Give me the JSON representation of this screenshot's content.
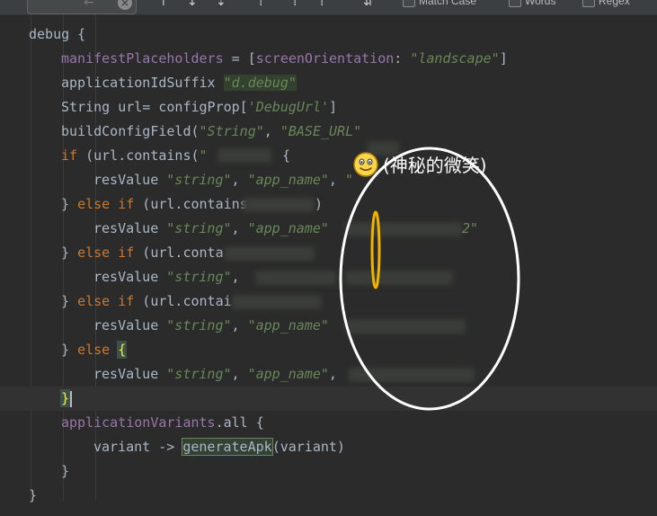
{
  "toolbar": {
    "match_case_label": "Match Case",
    "words_label": "Words",
    "regex_label": "Regex"
  },
  "code": {
    "l1_debug": "debug",
    "l1_brace": " {",
    "l2_prop": "manifestPlaceholders",
    "l2_eq": " = [",
    "l2_key": "screenOrientation",
    "l2_colon": ": ",
    "l2_val": "\"landscape\"",
    "l2_end": "]",
    "l3_fn": "applicationIdSuffix ",
    "l3_val": "\"d.debug\"",
    "l4_text": "String url= configProp[",
    "l4_val": "'DebugUrl'",
    "l4_end": "]",
    "l5_fn": "buildConfigField(",
    "l5_s1": "\"String\"",
    "l5_comma": ", ",
    "l5_s2": "\"BASE_URL\"",
    "l6_if": "if",
    "l6_rest": " (url.contains(",
    "l6_s": "\"",
    "l6_brace": "{",
    "l7_res": "resValue ",
    "l7_s1": "\"string\"",
    "l7_comma": ", ",
    "l7_s2": "\"app_name\"",
    "l7_comma2": ", ",
    "l7_s3": "\"",
    "l8_close": "} ",
    "l8_else": "else if",
    "l8_rest": " (url.contains",
    "l8_end": ")",
    "l9_res": "resValue ",
    "l9_s1": "\"string\"",
    "l9_comma": ", ",
    "l9_s2": "\"app_name\"",
    "l9_tail": "2\"",
    "l10_close": "} ",
    "l10_else": "else if",
    "l10_rest": " (url.conta",
    "l11_res": "resValue ",
    "l11_s1": "\"string\"",
    "l11_comma": ", ",
    "l11_s2": "\"app_name\"",
    "l12_close": "} ",
    "l12_else": "else if",
    "l12_rest": " (url.contai",
    "l13_res": "resValue ",
    "l13_s1": "\"string\"",
    "l13_comma": ", ",
    "l13_s2": "\"app_name\"",
    "l14_close": "} ",
    "l14_else": "else",
    "l14_sp": " ",
    "l14_brace": "{",
    "l15_res": "resValue ",
    "l15_s1": "\"string\"",
    "l15_comma": ", ",
    "l15_s2": "\"app_name\"",
    "l15_comma2": ",",
    "l16_brace": "}",
    "l17_prop": "applicationVariants",
    "l17_rest": ".all {",
    "l18_var": "variant -> ",
    "l18_fn": "generateApk",
    "l18_args": "(variant)",
    "l19_brace": "}",
    "l20_brace": "}"
  },
  "annotation": {
    "text": "(神秘的微笑)",
    "emoji_icon": "smiley-face-icon",
    "circle_color": "#ffffff",
    "cursor_color": "#f0b400"
  },
  "colors": {
    "background": "#2b2b2b",
    "keyword": "#cc7832",
    "string": "#6a8759",
    "property": "#9876aa",
    "text": "#a9b7c6"
  }
}
